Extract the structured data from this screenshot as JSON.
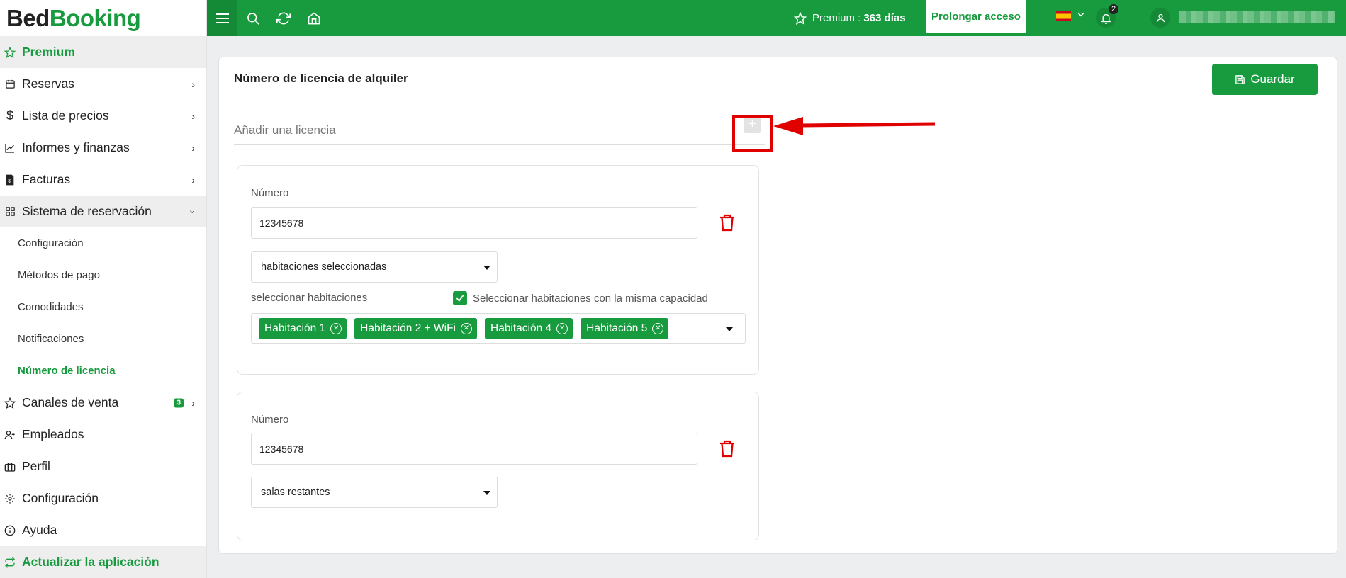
{
  "brand": {
    "part1": "Bed",
    "part2": "Booking"
  },
  "sidebar": {
    "items": [
      {
        "label": "Premium",
        "icon": "star-icon"
      },
      {
        "label": "Reservas",
        "icon": "calendar-icon"
      },
      {
        "label": "Lista de precios",
        "icon": "dollar-icon"
      },
      {
        "label": "Informes y finanzas",
        "icon": "chart-icon"
      },
      {
        "label": "Facturas",
        "icon": "invoice-icon"
      },
      {
        "label": "Sistema de reservación",
        "icon": "grid-icon"
      },
      {
        "label": "Canales de venta",
        "icon": "star-icon",
        "badge": "3"
      },
      {
        "label": "Empleados",
        "icon": "user-plus-icon"
      },
      {
        "label": "Perfil",
        "icon": "briefcase-icon"
      },
      {
        "label": "Configuración",
        "icon": "gear-icon"
      },
      {
        "label": "Ayuda",
        "icon": "info-icon"
      },
      {
        "label": "Actualizar la aplicación",
        "icon": "refresh-icon"
      }
    ],
    "subitems": [
      {
        "label": "Configuración"
      },
      {
        "label": "Métodos de pago"
      },
      {
        "label": "Comodidades"
      },
      {
        "label": "Notificaciones"
      },
      {
        "label": "Número de licencia"
      }
    ]
  },
  "topbar": {
    "premium_label": "Premium :",
    "premium_days": "363 días",
    "extend_label": "Prolongar acceso",
    "notifications_count": "2",
    "accent": "#179b3e"
  },
  "main": {
    "title": "Número de licencia de alquiler",
    "save_label": "Guardar",
    "add_label": "Añadir una licencia",
    "add_symbol": "+",
    "licenses": [
      {
        "number_label": "Número",
        "number_value": "12345678",
        "scope": "habitaciones seleccionadas",
        "rooms_label": "seleccionar habitaciones",
        "same_capacity_label": "Seleccionar habitaciones con la misma capacidad",
        "same_capacity_checked": true,
        "rooms": [
          "Habitación 1",
          "Habitación 2 + WiFi",
          "Habitación 4",
          "Habitación 5"
        ]
      },
      {
        "number_label": "Número",
        "number_value": "12345678",
        "scope": "salas restantes"
      }
    ]
  }
}
